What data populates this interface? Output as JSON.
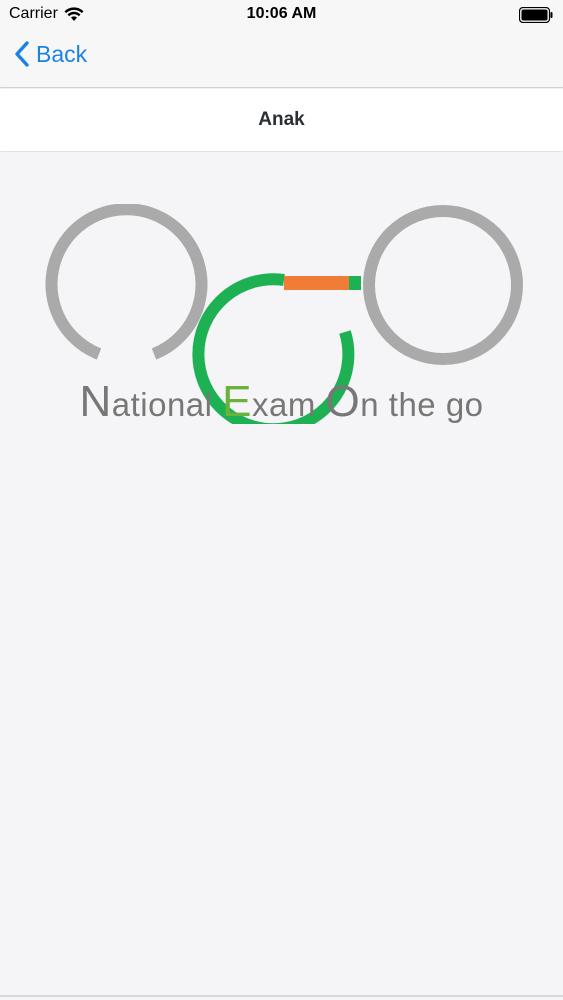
{
  "status_bar": {
    "carrier": "Carrier",
    "time": "10:06 AM"
  },
  "nav": {
    "back_label": "Back"
  },
  "header": {
    "title": "Anak"
  },
  "logo": {
    "caption": {
      "n": "N",
      "national": "ational ",
      "e": "E",
      "exam": "xam ",
      "o": "O",
      "on_the_go": "n the go"
    },
    "colors": {
      "gray": "#aaaaaa",
      "green": "#1db154",
      "orange": "#f07c36"
    }
  }
}
